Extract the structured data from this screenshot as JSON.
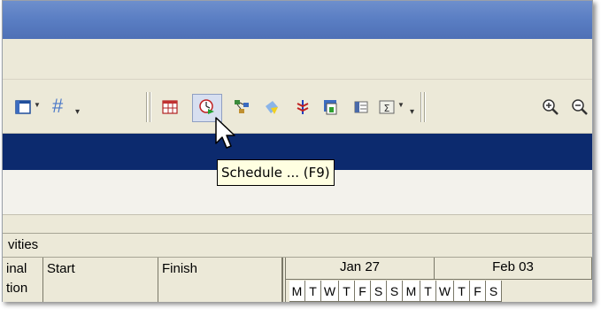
{
  "toolbar": {
    "icons": [
      "layout-icon",
      "hash-icon",
      "table-view-icon",
      "schedule-clock-icon",
      "network-icon",
      "pencil-shape-icon",
      "level-icon",
      "store-icon",
      "columns-icon",
      "summary-icon",
      "zoom-in-icon",
      "zoom-out-icon"
    ],
    "hash_label": "#"
  },
  "tooltip": {
    "text": "Schedule ... (F9)"
  },
  "section": {
    "label": "vities"
  },
  "table": {
    "columns": [
      {
        "line1": "inal",
        "line2": "tion"
      },
      {
        "line1": "Start",
        "line2": ""
      },
      {
        "line1": "Finish",
        "line2": ""
      }
    ]
  },
  "gantt": {
    "weeks": [
      "Jan 27",
      "Feb 03"
    ],
    "days": [
      "M",
      "T",
      "W",
      "T",
      "F",
      "S",
      "S",
      "M",
      "T",
      "W",
      "T",
      "F",
      "S"
    ]
  },
  "colors": {
    "titlebar": "#5b7fc4",
    "selection_bar": "#0c2a6e",
    "tooltip_bg": "#ffffe1",
    "chrome": "#ece9d8"
  }
}
